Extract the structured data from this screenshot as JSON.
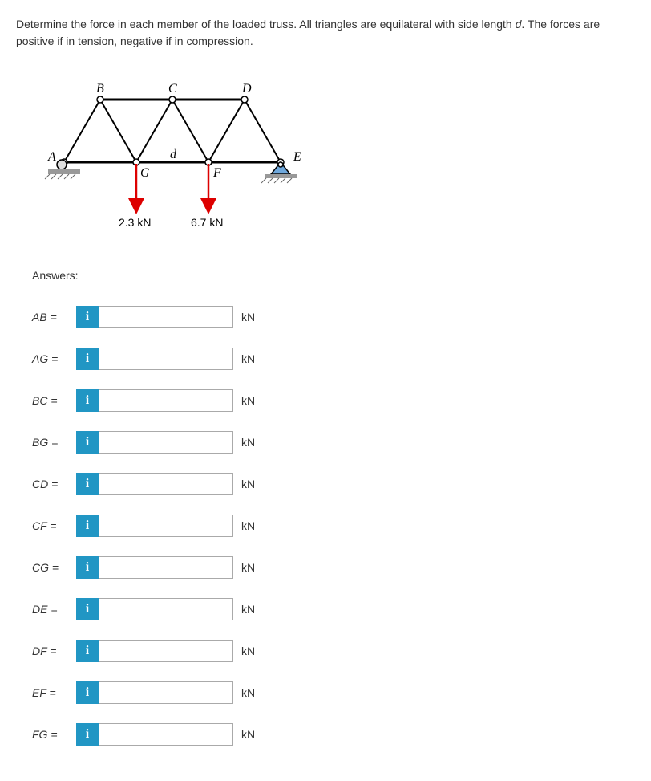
{
  "problem": {
    "text1": "Determine the force in each member of the loaded truss. All triangles are equilateral with side length ",
    "var": "d",
    "text2": ". The forces are positive if in tension, negative if in compression."
  },
  "diagram": {
    "nodes": {
      "A": "A",
      "B": "B",
      "C": "C",
      "D": "D",
      "E": "E",
      "F": "F",
      "G": "G"
    },
    "dim_label": "d",
    "force1": "2.3 kN",
    "force2": "6.7 kN"
  },
  "answers_label": "Answers:",
  "unit": "kN",
  "info_icon": "i",
  "rows": [
    {
      "label": "AB ="
    },
    {
      "label": "AG ="
    },
    {
      "label": "BC ="
    },
    {
      "label": "BG ="
    },
    {
      "label": "CD ="
    },
    {
      "label": "CF ="
    },
    {
      "label": "CG ="
    },
    {
      "label": "DE ="
    },
    {
      "label": "DF ="
    },
    {
      "label": "EF ="
    },
    {
      "label": "FG ="
    }
  ]
}
